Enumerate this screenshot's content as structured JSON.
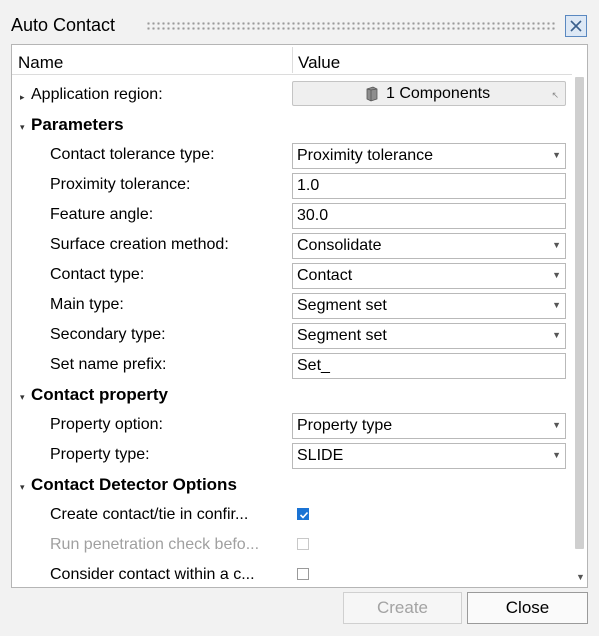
{
  "window": {
    "title": "Auto Contact",
    "close_icon": "close-x-icon"
  },
  "columns": {
    "name": "Name",
    "value": "Value"
  },
  "rows": {
    "app_region": {
      "label": "Application region:",
      "value": "1 Components"
    },
    "parameters": {
      "label": "Parameters"
    },
    "contact_tol_type": {
      "label": "Contact tolerance type:",
      "value": "Proximity tolerance"
    },
    "proximity_tol": {
      "label": "Proximity tolerance:",
      "value": "1.0"
    },
    "feature_angle": {
      "label": "Feature angle:",
      "value": "30.0"
    },
    "surface_method": {
      "label": "Surface creation method:",
      "value": "Consolidate"
    },
    "contact_type": {
      "label": "Contact type:",
      "value": "Contact"
    },
    "main_type": {
      "label": "Main type:",
      "value": "Segment set"
    },
    "secondary_type": {
      "label": "Secondary type:",
      "value": "Segment set"
    },
    "set_prefix": {
      "label": "Set name prefix:",
      "value": "Set_"
    },
    "contact_property": {
      "label": "Contact property"
    },
    "property_option": {
      "label": "Property option:",
      "value": "Property type"
    },
    "property_type": {
      "label": "Property type:",
      "value": "SLIDE"
    },
    "detector": {
      "label": "Contact Detector Options"
    },
    "create_contact": {
      "label": "Create contact/tie in confir...",
      "checked": true
    },
    "run_penetration": {
      "label": "Run penetration check befo...",
      "checked": false,
      "disabled": true
    },
    "consider_contact": {
      "label": "Consider contact within a c...",
      "checked": false
    }
  },
  "buttons": {
    "create": "Create",
    "close": "Close"
  },
  "colors": {
    "accent": "#1a73d4",
    "disabled_text": "#a0a0a0"
  }
}
